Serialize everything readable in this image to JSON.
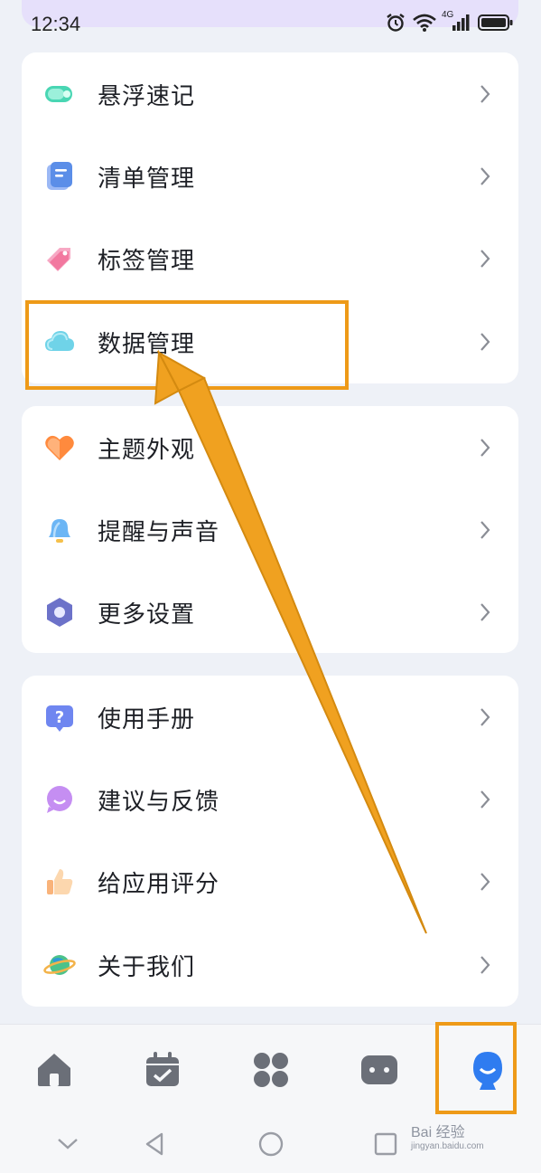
{
  "status_bar": {
    "time": "12:34",
    "network": "4G",
    "icons": [
      "alarm-icon",
      "wifi-icon",
      "signal-icon",
      "battery-icon"
    ]
  },
  "groups": [
    {
      "items": [
        {
          "label": "悬浮速记",
          "icon": "floating-note-icon"
        },
        {
          "label": "清单管理",
          "icon": "list-icon"
        },
        {
          "label": "标签管理",
          "icon": "tag-icon"
        },
        {
          "label": "数据管理",
          "icon": "cloud-icon"
        }
      ]
    },
    {
      "items": [
        {
          "label": "主题外观",
          "icon": "heart-theme-icon"
        },
        {
          "label": "提醒与声音",
          "icon": "bell-icon"
        },
        {
          "label": "更多设置",
          "icon": "hexagon-settings-icon"
        }
      ]
    },
    {
      "items": [
        {
          "label": "使用手册",
          "icon": "help-manual-icon"
        },
        {
          "label": "建议与反馈",
          "icon": "feedback-bubble-icon"
        },
        {
          "label": "给应用评分",
          "icon": "thumbs-up-icon"
        },
        {
          "label": "关于我们",
          "icon": "planet-icon"
        }
      ]
    }
  ],
  "tab_bar": {
    "tabs": [
      "home-icon",
      "calendar-icon",
      "apps-grid-icon",
      "widget-icon",
      "profile-icon"
    ],
    "active": "profile-icon"
  },
  "nav_bar": [
    "back-down-icon",
    "back-triangle-icon",
    "home-circle-icon",
    "recent-square-icon"
  ],
  "annotation_color": "#ee9a18",
  "watermark": {
    "line1": "Bai 经验",
    "line2": "jingyan.baidu.com"
  }
}
